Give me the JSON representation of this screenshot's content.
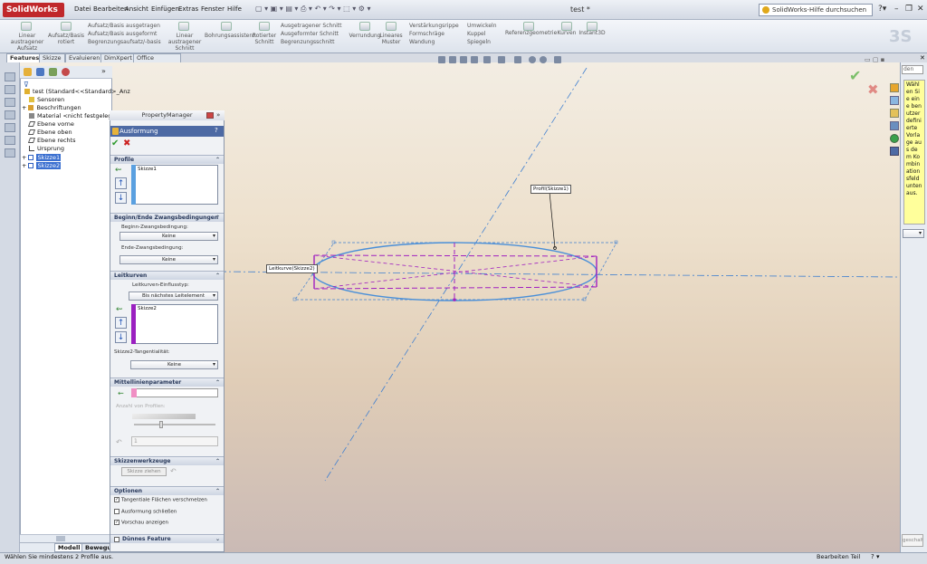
{
  "app": {
    "logo": "SolidWorks",
    "doc_title": "test *",
    "help_placeholder": "SolidWorks-Hilfe durchsuchen"
  },
  "menu": [
    "Datei",
    "Bearbeiten",
    "Ansicht",
    "Einfügen",
    "Extras",
    "Fenster",
    "Hilfe"
  ],
  "ribbon": {
    "items": [
      {
        "label": "Linear\naustragener\nAufsatz"
      },
      {
        "label": "Aufsatz/Basis\nrotiert"
      },
      {
        "label": "Linear\naustragener\nSchnitt"
      },
      {
        "label": "Bohrungsassistent"
      },
      {
        "label": "Rotierter\nSchnitt"
      },
      {
        "label": "Verrundung"
      },
      {
        "label": "Lineares\nMuster"
      },
      {
        "label": "Referenzgeometrie"
      },
      {
        "label": "Kurven"
      },
      {
        "label": "Instant3D"
      }
    ],
    "small": [
      "Aufsatz/Basis ausgetragen",
      "Aufsatz/Basis ausgeformt",
      "Begrenzungsaufsatz/-basis",
      "Ausgetragener Schnitt",
      "Ausgeformter Schnitt",
      "Begrenzungsschnitt",
      "Verstärkungsrippe",
      "Formschräge",
      "Wandung",
      "Umwickeln",
      "Kuppel",
      "Spiegeln"
    ]
  },
  "tabs": [
    "Features",
    "Skizze",
    "Evaluieren",
    "DimXpert",
    "Office Produkte"
  ],
  "tree": {
    "items": [
      "test (Standard<<Standard>_Anz",
      "Sensoren",
      "Beschriftungen",
      "Material <nicht festgelegt>",
      "Ebene vorne",
      "Ebene oben",
      "Ebene rechts",
      "Ursprung",
      "Skizze1",
      "Skizze2"
    ]
  },
  "pm": {
    "header": "PropertyManager",
    "feature": "Ausformung",
    "sections": {
      "profile": "Profile",
      "constraints": "Beginn/Ende Zwangsbedingungen",
      "guides": "Leitkurven",
      "centerline": "Mittellinienparameter",
      "sketchtools": "Skizzenwerkzeuge",
      "options": "Optionen",
      "thin": "Dünnes Feature"
    },
    "profile_list": [
      "Skizze1"
    ],
    "start_label": "Beginn-Zwangsbedingung:",
    "start_value": "Keine",
    "end_label": "Ende-Zwangsbedingung:",
    "end_value": "Keine",
    "guide_influence_label": "Leitkurven-Einflusstyp:",
    "guide_influence_value": "Bis nächstes Leitelement",
    "guide_list": [
      "Skizze2"
    ],
    "tangency_label": "Skizze2-Tangentialität:",
    "tangency_value": "Keine",
    "sections_count_label": "Anzahl von Profilen:",
    "sections_value": "1",
    "drag_sketch": "Skizze ziehen",
    "opt1": "Tangentiale Flächen verschmelzen",
    "opt2": "Ausformung schließen",
    "opt3": "Vorschau anzeigen"
  },
  "viewport": {
    "profile_callout": "Profil(Skizze1)",
    "guide_callout": "Leitkurve(Skizze2)"
  },
  "tip": "Wählen Sie eine benutzerdefinierte Vorlage aus dem Kombinationsfeld unten aus.",
  "tree_bottom": {
    "tab1": "Modell",
    "tab2": "Bewegun"
  },
  "status": {
    "left": "Wählen Sie mindestens 2 Profile aus.",
    "right": "Bearbeiten Teil"
  },
  "right_pane": {
    "search": "den",
    "bottom": "geschalt"
  }
}
